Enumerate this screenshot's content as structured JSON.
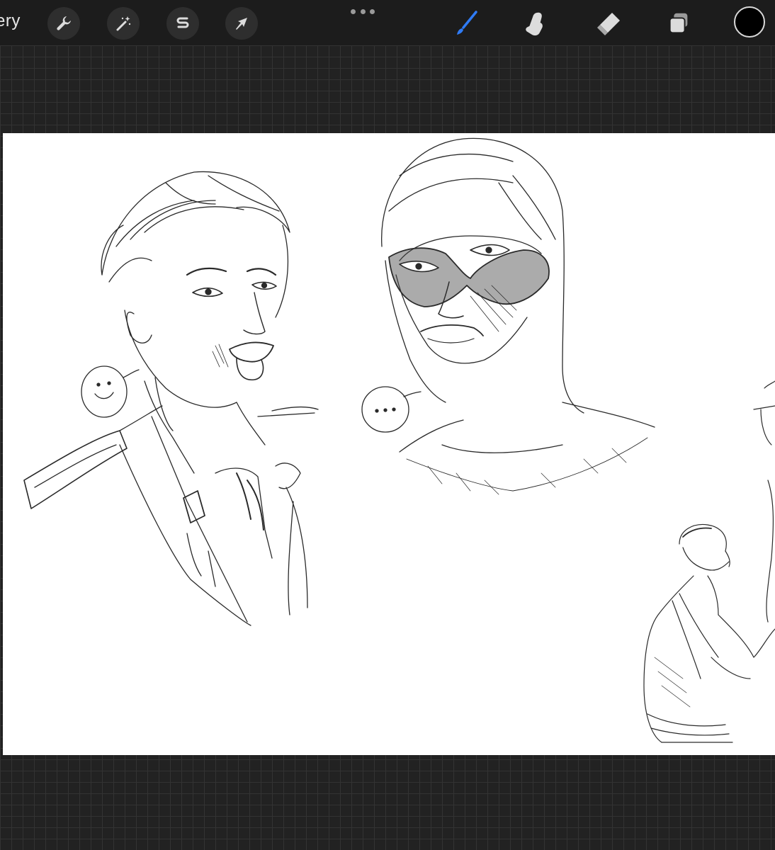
{
  "toolbar": {
    "gallery_label": "ery",
    "left_tools": [
      {
        "name": "actions",
        "icon": "wrench-icon"
      },
      {
        "name": "adjustments",
        "icon": "magic-wand-icon"
      },
      {
        "name": "selection",
        "icon": "selection-s-icon"
      },
      {
        "name": "transform",
        "icon": "arrow-cursor-icon"
      }
    ],
    "right_tools": [
      {
        "name": "brush",
        "icon": "brush-icon",
        "active": true
      },
      {
        "name": "smudge",
        "icon": "smudge-finger-icon",
        "active": false
      },
      {
        "name": "eraser",
        "icon": "eraser-icon",
        "active": false
      },
      {
        "name": "layers",
        "icon": "layers-icon",
        "active": false
      }
    ],
    "current_color": "#000000",
    "accent_color": "#2f7bf5"
  },
  "canvas": {
    "background": "#ffffff",
    "sketches": [
      "uniformed-man-portrait",
      "masked-figure-portrait",
      "man-reaching-figure"
    ],
    "speech_bubbles": [
      {
        "content": "smiley face"
      },
      {
        "content": "ellipsis"
      }
    ]
  }
}
